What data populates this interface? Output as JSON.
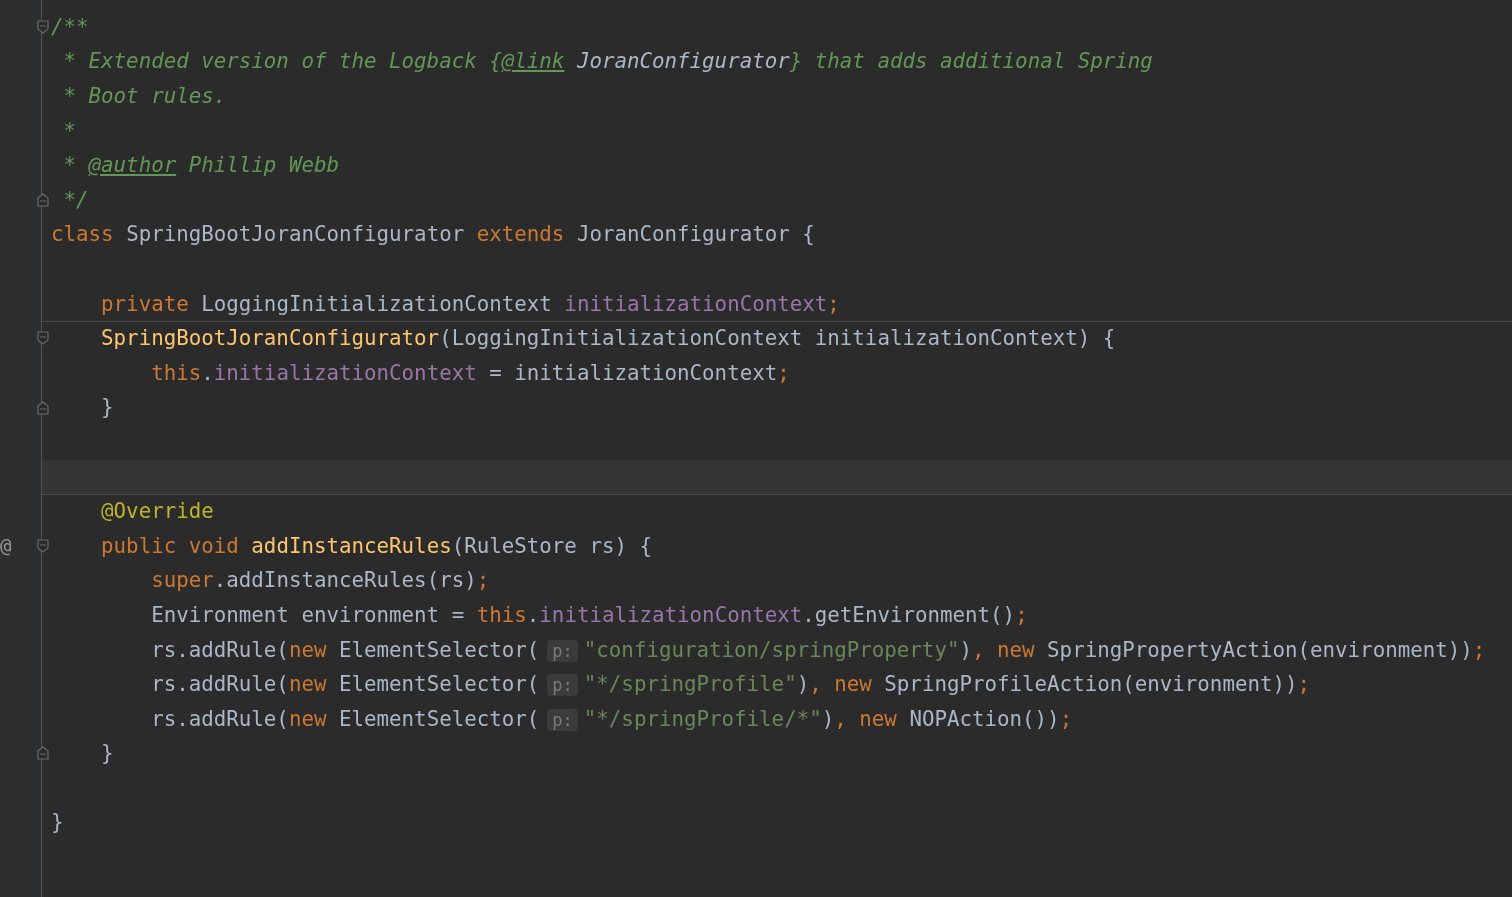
{
  "editor": {
    "lines": [
      {
        "fold_open": true,
        "tokens": [
          {
            "text": "/**",
            "kind": "comment"
          }
        ]
      },
      {
        "tokens": [
          {
            "text": " * Extended version of the Logback {",
            "kind": "comment"
          },
          {
            "text": "@link",
            "kind": "doctag"
          },
          {
            "text": " JoranConfigurator",
            "kind": "docref"
          },
          {
            "text": "} that adds additional Spring",
            "kind": "comment"
          }
        ]
      },
      {
        "tokens": [
          {
            "text": " * Boot rules.",
            "kind": "comment"
          }
        ]
      },
      {
        "tokens": [
          {
            "text": " *",
            "kind": "comment"
          }
        ]
      },
      {
        "tokens": [
          {
            "text": " * ",
            "kind": "comment"
          },
          {
            "text": "@author",
            "kind": "doctag"
          },
          {
            "text": " Phillip Webb",
            "kind": "comment"
          }
        ]
      },
      {
        "fold_close": true,
        "tokens": [
          {
            "text": " */",
            "kind": "comment"
          }
        ]
      },
      {
        "tokens": [
          {
            "text": "class",
            "kind": "keyword"
          },
          {
            "text": " SpringBootJoranConfigurator ",
            "kind": "plain"
          },
          {
            "text": "extends",
            "kind": "keyword"
          },
          {
            "text": " JoranConfigurator {",
            "kind": "plain"
          }
        ]
      },
      {
        "space_above": true,
        "tokens": [
          {
            "text": "    private",
            "kind": "keyword"
          },
          {
            "text": " LoggingInitializationContext ",
            "kind": "plain"
          },
          {
            "text": "initializationContext",
            "kind": "field"
          },
          {
            "text": ";",
            "kind": "keyword"
          }
        ]
      },
      {
        "fold_open": true,
        "separator_above": true,
        "tokens": [
          {
            "text": "    SpringBootJoranConfigurator",
            "kind": "method"
          },
          {
            "text": "(LoggingInitializationContext initializationContext) {",
            "kind": "plain"
          }
        ]
      },
      {
        "tokens": [
          {
            "text": "        this",
            "kind": "keyword"
          },
          {
            "text": ".",
            "kind": "plain"
          },
          {
            "text": "initializationContext",
            "kind": "field"
          },
          {
            "text": " = initializationContext",
            "kind": "plain"
          },
          {
            "text": ";",
            "kind": "keyword"
          }
        ]
      },
      {
        "fold_close": true,
        "tokens": [
          {
            "text": "    }",
            "kind": "plain"
          }
        ]
      },
      {
        "space_above": true,
        "current": true
      },
      {
        "separator_above": true,
        "tokens": [
          {
            "text": "    @Override",
            "kind": "annotation"
          }
        ]
      },
      {
        "fold_open": true,
        "gutter_mark": "@",
        "tokens": [
          {
            "text": "    public void ",
            "kind": "keyword"
          },
          {
            "text": "addInstanceRules",
            "kind": "method"
          },
          {
            "text": "(RuleStore rs) {",
            "kind": "plain"
          }
        ]
      },
      {
        "tokens": [
          {
            "text": "        super",
            "kind": "keyword"
          },
          {
            "text": ".addInstanceRules(rs)",
            "kind": "plain"
          },
          {
            "text": ";",
            "kind": "keyword"
          }
        ]
      },
      {
        "tokens": [
          {
            "text": "        Environment environment = ",
            "kind": "plain"
          },
          {
            "text": "this",
            "kind": "keyword"
          },
          {
            "text": ".",
            "kind": "plain"
          },
          {
            "text": "initializationContext",
            "kind": "field"
          },
          {
            "text": ".getEnvironment()",
            "kind": "plain"
          },
          {
            "text": ";",
            "kind": "keyword"
          }
        ]
      },
      {
        "tokens": [
          {
            "text": "        rs.addRule(",
            "kind": "plain"
          },
          {
            "text": "new",
            "kind": "keyword"
          },
          {
            "text": " ElementSelector(",
            "kind": "plain"
          },
          {
            "text": "p:",
            "kind": "hint"
          },
          {
            "text": "\"configuration/springProperty\"",
            "kind": "string"
          },
          {
            "text": ")",
            "kind": "plain"
          },
          {
            "text": ", new",
            "kind": "keyword"
          },
          {
            "text": " SpringPropertyAction(environment))",
            "kind": "plain"
          },
          {
            "text": ";",
            "kind": "keyword"
          }
        ]
      },
      {
        "tokens": [
          {
            "text": "        rs.addRule(",
            "kind": "plain"
          },
          {
            "text": "new",
            "kind": "keyword"
          },
          {
            "text": " ElementSelector(",
            "kind": "plain"
          },
          {
            "text": "p:",
            "kind": "hint"
          },
          {
            "text": "\"*/springProfile\"",
            "kind": "string"
          },
          {
            "text": ")",
            "kind": "plain"
          },
          {
            "text": ", new",
            "kind": "keyword"
          },
          {
            "text": " SpringProfileAction(environment))",
            "kind": "plain"
          },
          {
            "text": ";",
            "kind": "keyword"
          }
        ]
      },
      {
        "tokens": [
          {
            "text": "        rs.addRule(",
            "kind": "plain"
          },
          {
            "text": "new",
            "kind": "keyword"
          },
          {
            "text": " ElementSelector(",
            "kind": "plain"
          },
          {
            "text": "p:",
            "kind": "hint"
          },
          {
            "text": "\"*/springProfile/*\"",
            "kind": "string"
          },
          {
            "text": ")",
            "kind": "plain"
          },
          {
            "text": ", new",
            "kind": "keyword"
          },
          {
            "text": " NOPAction())",
            "kind": "plain"
          },
          {
            "text": ";",
            "kind": "keyword"
          }
        ]
      },
      {
        "fold_close": true,
        "tokens": [
          {
            "text": "    }",
            "kind": "plain"
          }
        ]
      },
      {
        "space_above": true,
        "tokens": [
          {
            "text": "}",
            "kind": "plain"
          }
        ]
      }
    ]
  }
}
